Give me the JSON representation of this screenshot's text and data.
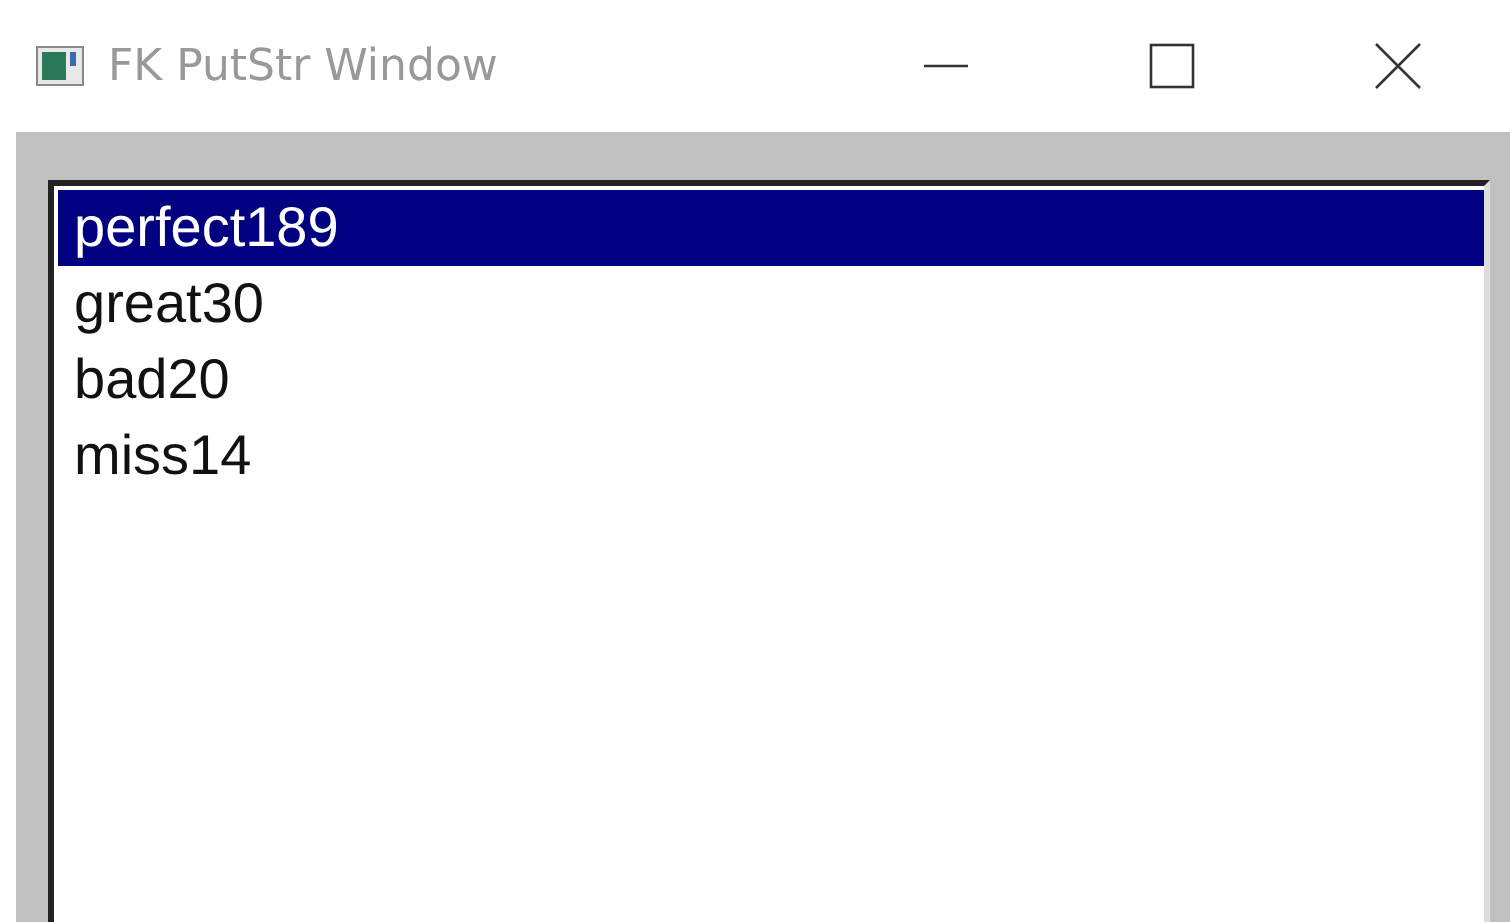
{
  "window": {
    "title": "FK PutStr Window"
  },
  "list": {
    "items": [
      {
        "label": "perfect189",
        "selected": true
      },
      {
        "label": "great30",
        "selected": false
      },
      {
        "label": "bad20",
        "selected": false
      },
      {
        "label": "miss14",
        "selected": false
      }
    ]
  }
}
